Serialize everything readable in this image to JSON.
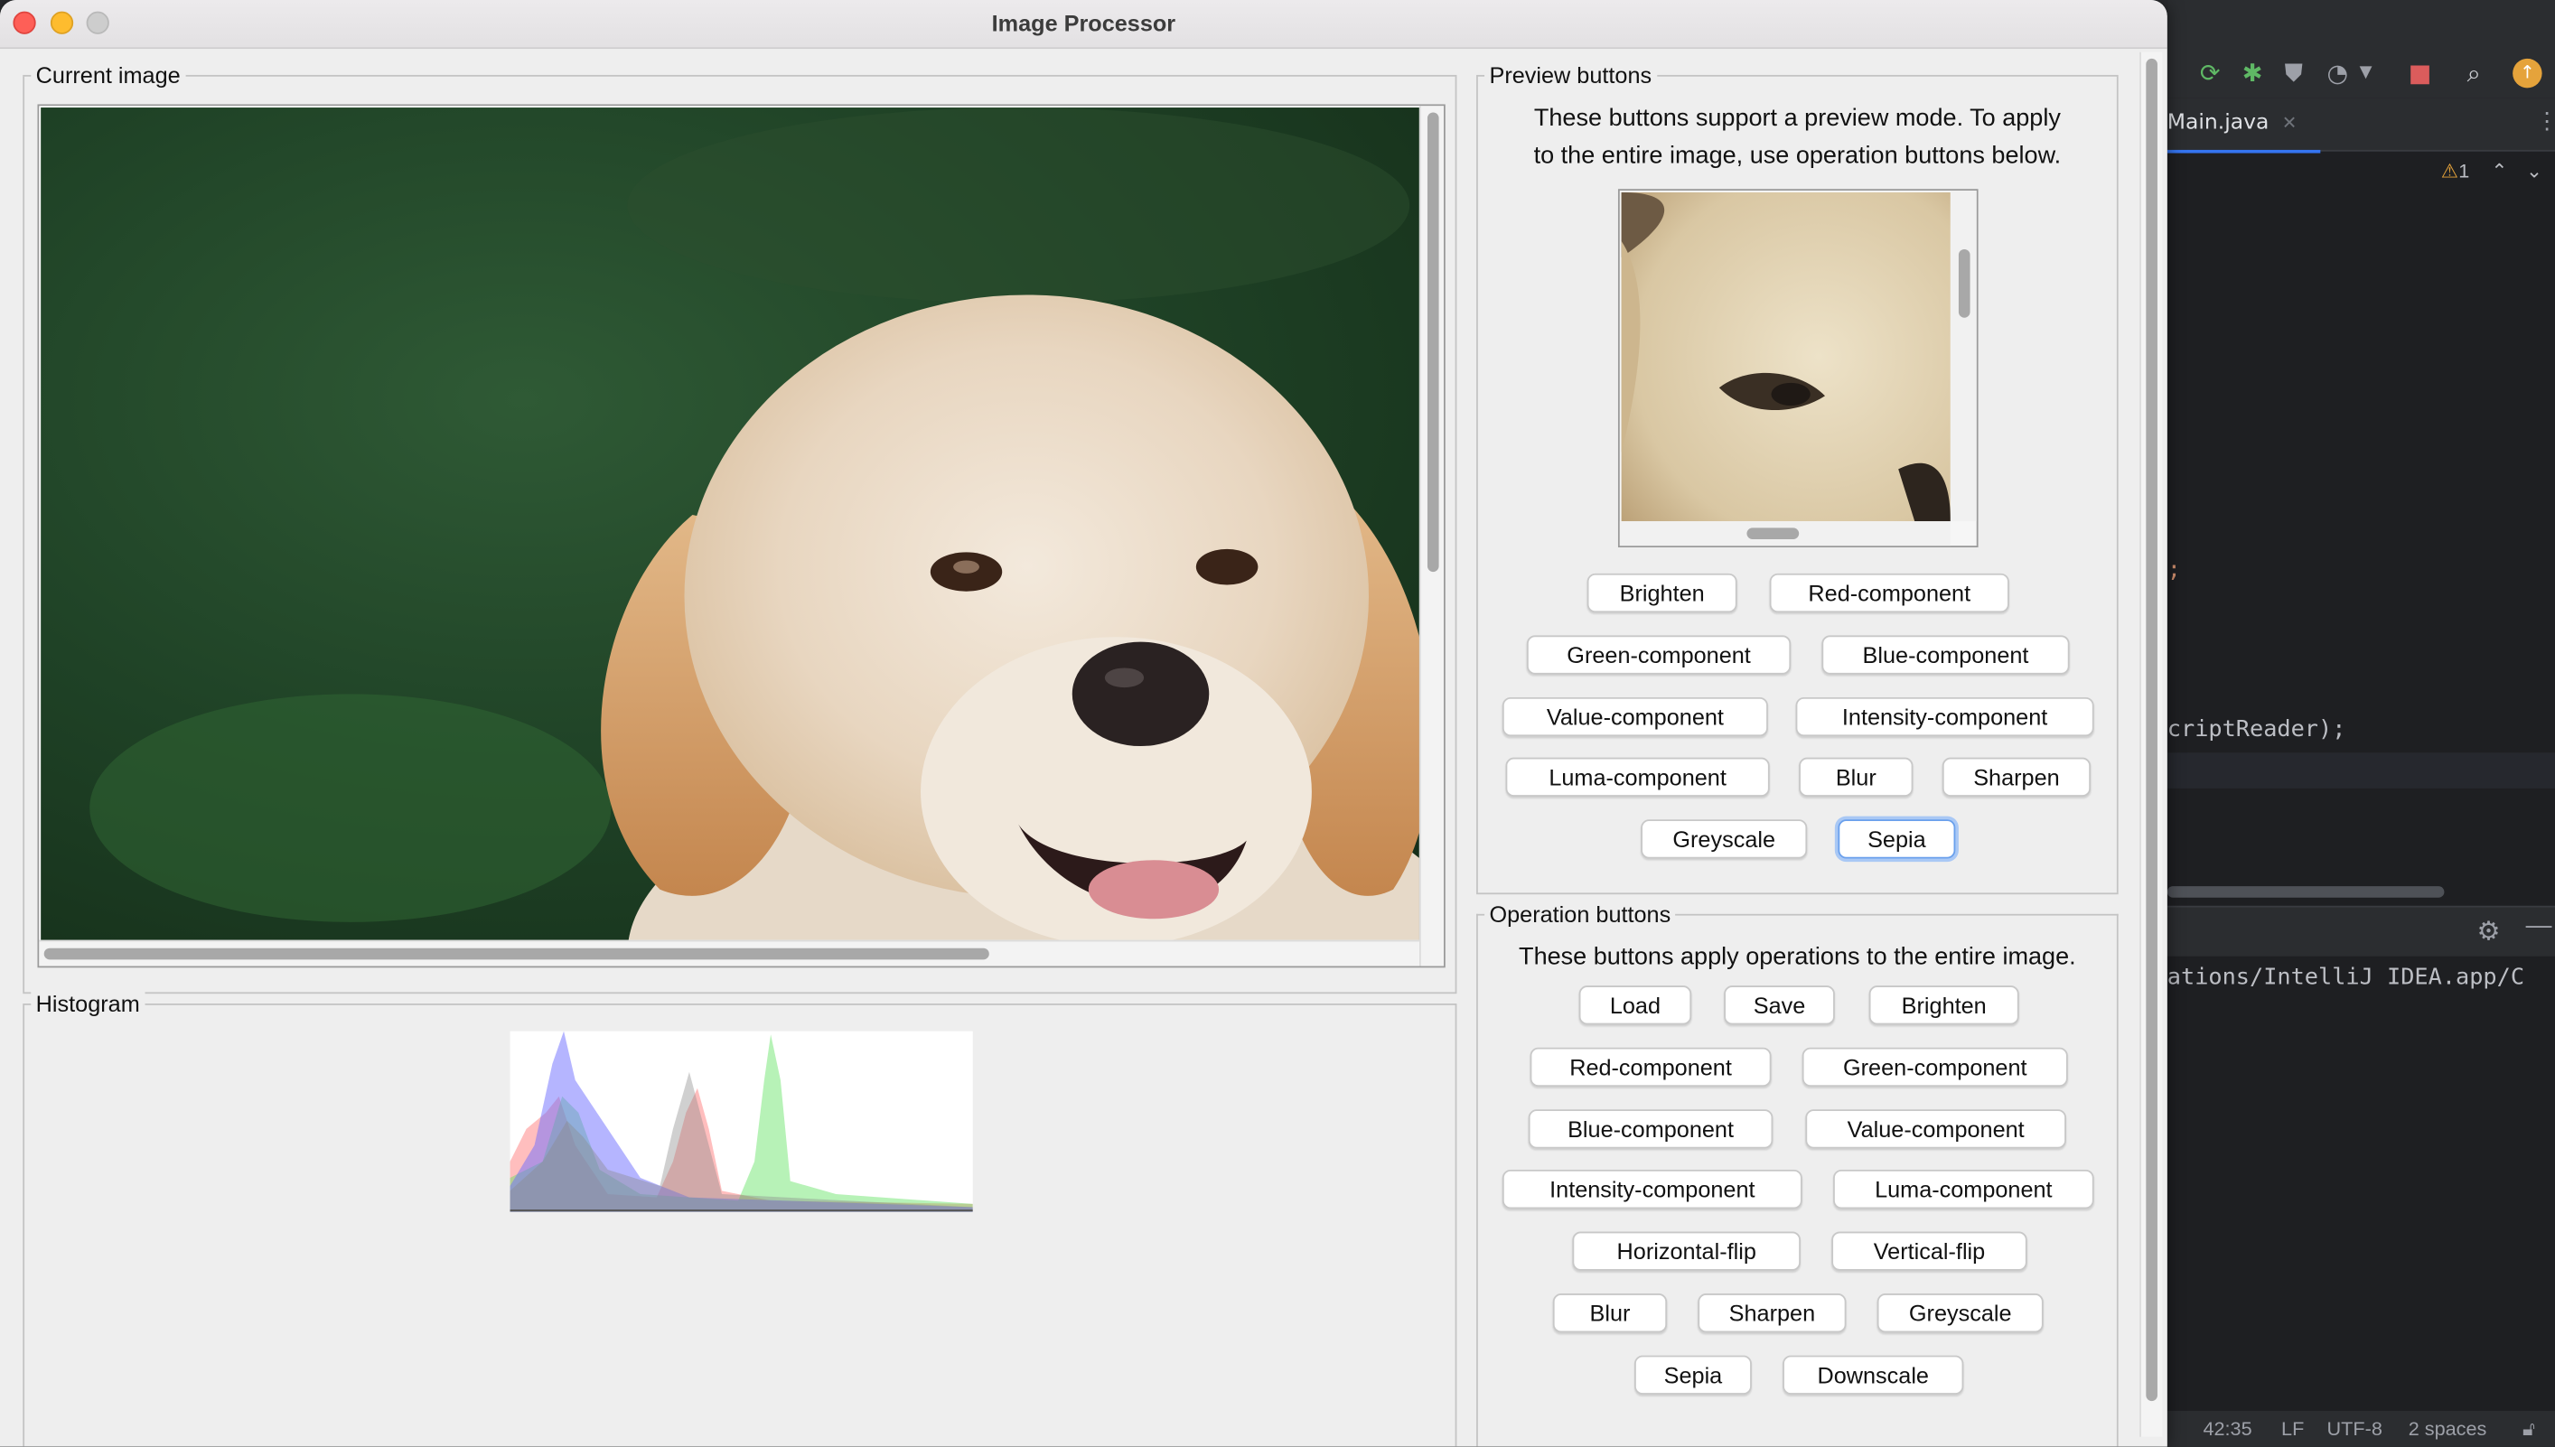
{
  "window": {
    "title": "Image Processor"
  },
  "current_image": {
    "legend": "Current image"
  },
  "histogram": {
    "legend": "Histogram"
  },
  "preview": {
    "legend": "Preview buttons",
    "description_line1": "These buttons support a preview mode. To apply",
    "description_line2": "to the entire image, use operation buttons below.",
    "buttons": [
      "Brighten",
      "Red-component",
      "Green-component",
      "Blue-component",
      "Value-component",
      "Intensity-component",
      "Luma-component",
      "Blur",
      "Sharpen",
      "Greyscale",
      "Sepia"
    ],
    "focused_button": "Sepia"
  },
  "operations": {
    "legend": "Operation buttons",
    "description": "These buttons apply operations to the entire image.",
    "buttons": [
      "Load",
      "Save",
      "Brighten",
      "Red-component",
      "Green-component",
      "Blue-component",
      "Value-component",
      "Intensity-component",
      "Luma-component",
      "Horizontal-flip",
      "Vertical-flip",
      "Blur",
      "Sharpen",
      "Greyscale",
      "Sepia",
      "Downscale"
    ]
  },
  "ide": {
    "tab": "Main.java",
    "warning_count": "1",
    "code_fragment_1": ";",
    "code_fragment_2": "criptReader);",
    "console_path": "ations/IntelliJ IDEA.app/C",
    "status": {
      "position": "42:35",
      "line_sep": "LF",
      "encoding": "UTF-8",
      "indent": "2 spaces"
    }
  },
  "colors": {
    "close": "#fe5f57",
    "minimize": "#febc2e",
    "zoom": "#c8c8c8",
    "focus": "#6aa0ec"
  }
}
